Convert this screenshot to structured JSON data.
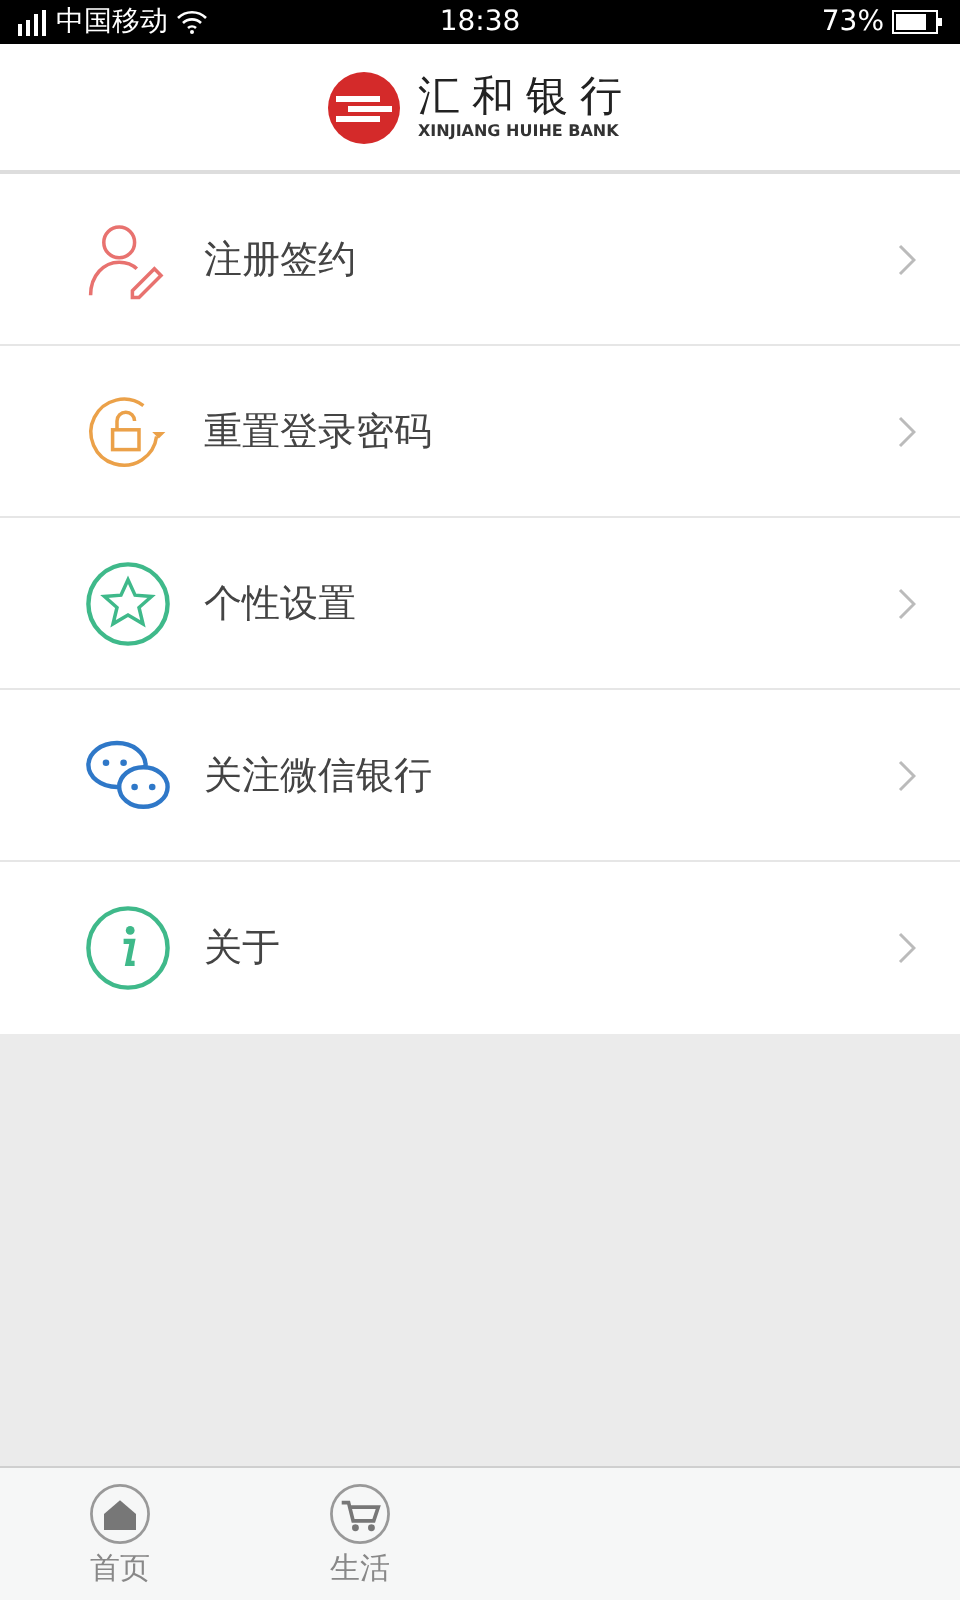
{
  "status_bar": {
    "carrier": "中国移动",
    "time": "18:38",
    "battery": "73%"
  },
  "header": {
    "logo_title": "汇和银行",
    "logo_subtitle": "XINJIANG HUIHE BANK"
  },
  "menu": [
    {
      "kind": "register",
      "label": "注册签约",
      "color": "#e8726f"
    },
    {
      "kind": "reset",
      "label": "重置登录密码",
      "color": "#eba149"
    },
    {
      "kind": "star",
      "label": "个性设置",
      "color": "#3fb98a"
    },
    {
      "kind": "wechat",
      "label": "关注微信银行",
      "color": "#2f78c8"
    },
    {
      "kind": "info",
      "label": "关于",
      "color": "#3fb98a"
    }
  ],
  "tab_bar": [
    {
      "kind": "home",
      "label": "首页",
      "selected": false
    },
    {
      "kind": "cart",
      "label": "生活",
      "selected": false
    }
  ]
}
